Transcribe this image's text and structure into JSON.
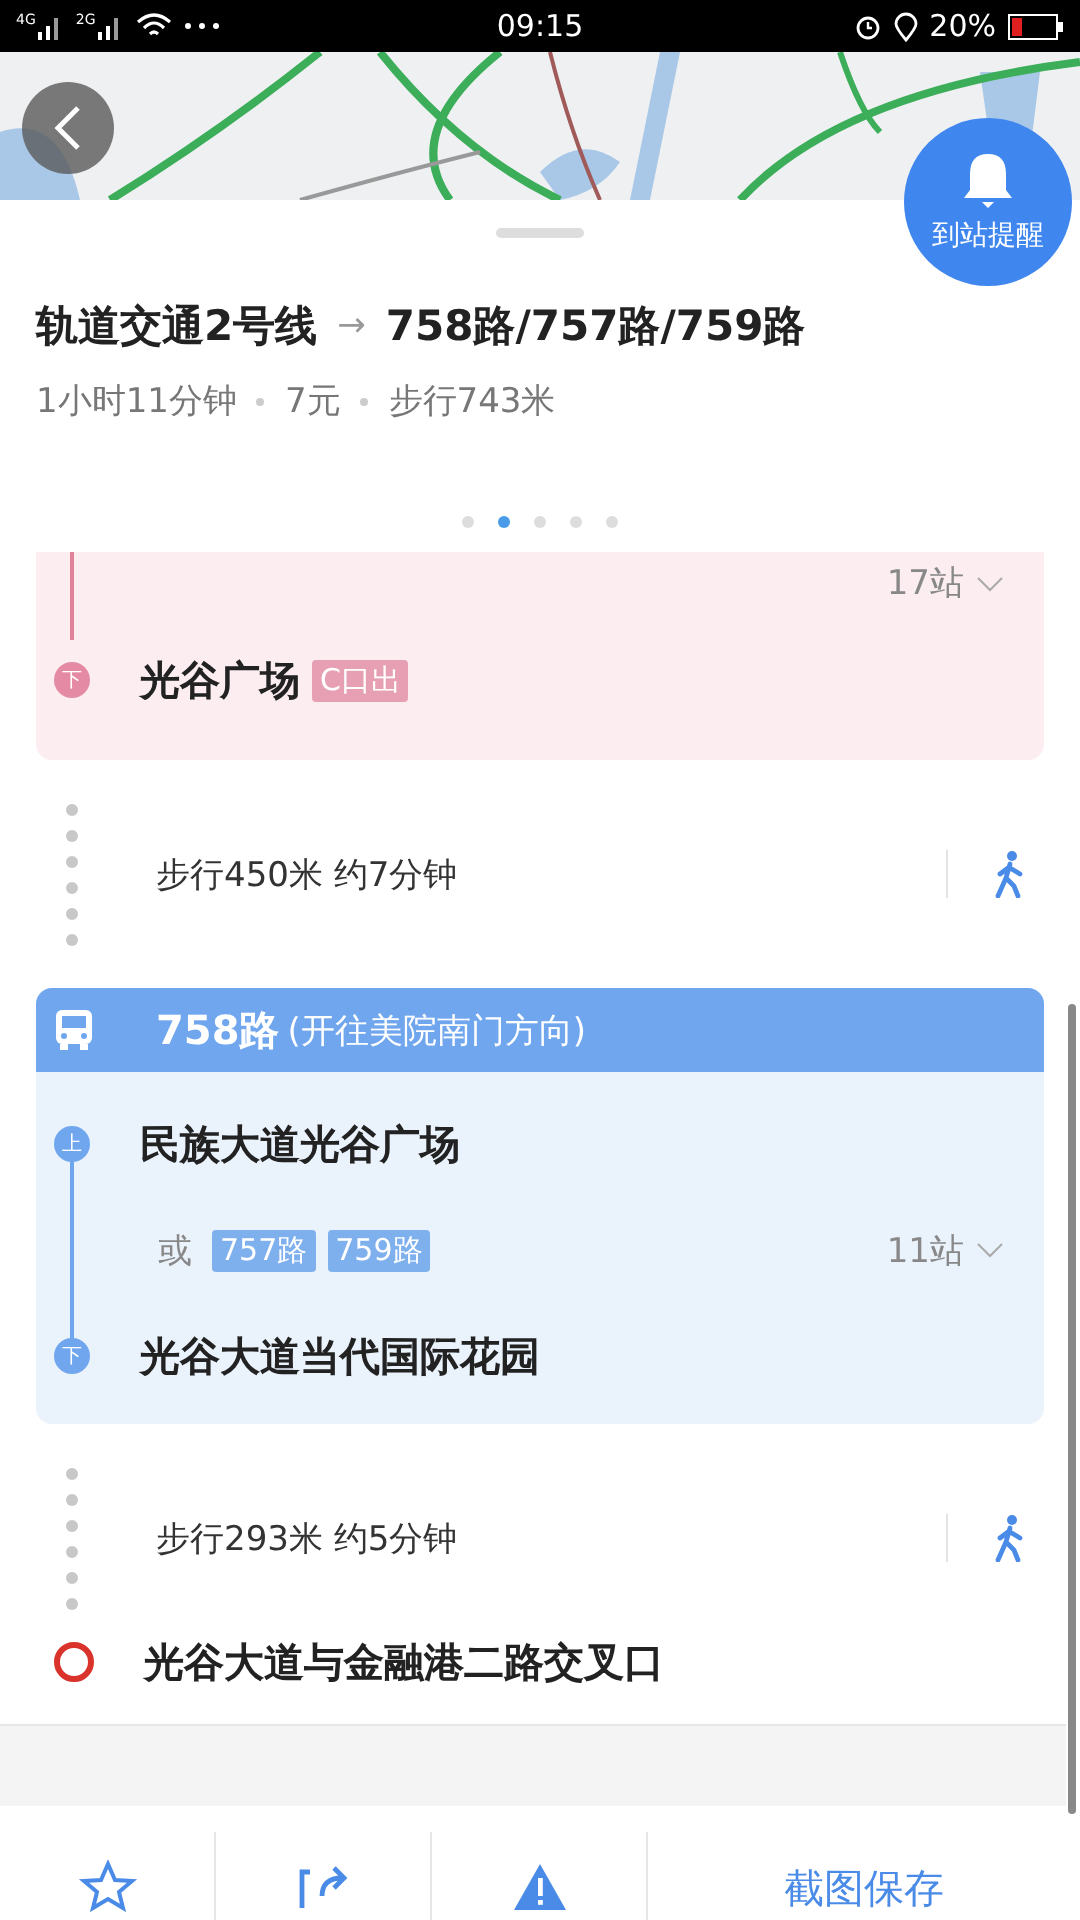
{
  "status_bar": {
    "networks": [
      "4G",
      "2G"
    ],
    "time": "09:15",
    "battery": "20%"
  },
  "reminder_button": {
    "label": "到站提醒"
  },
  "route": {
    "from": "轨道交通2号线",
    "arrow": "→",
    "to": "758路/757路/759路",
    "summary": [
      "1小时11分钟",
      "7元",
      "步行743米"
    ]
  },
  "page_dots": [
    {
      "selected": false
    },
    {
      "selected": true
    },
    {
      "selected": false
    },
    {
      "selected": false
    },
    {
      "selected": false
    }
  ],
  "segments": [
    {
      "kind": "rail",
      "stop_count": "17站",
      "stop": {
        "mark": "下",
        "name": "光谷广场",
        "tag": "C口出"
      }
    },
    {
      "kind": "walk",
      "text": "步行450米 约7分钟"
    },
    {
      "kind": "bus",
      "line": "758路",
      "direction": "(开往美院南门方向)",
      "board": {
        "mark": "上",
        "name": "民族大道光谷广场"
      },
      "or": "或",
      "alternatives": [
        "757路",
        "759路"
      ],
      "stop_count": "11站",
      "alight": {
        "mark": "下",
        "name": "光谷大道当代国际花园"
      }
    },
    {
      "kind": "walk",
      "text": "步行293米 约5分钟"
    },
    {
      "kind": "destination",
      "name": "光谷大道与金融港二路交叉口"
    }
  ],
  "bottom_bar": {
    "save_label": "截图保存"
  }
}
